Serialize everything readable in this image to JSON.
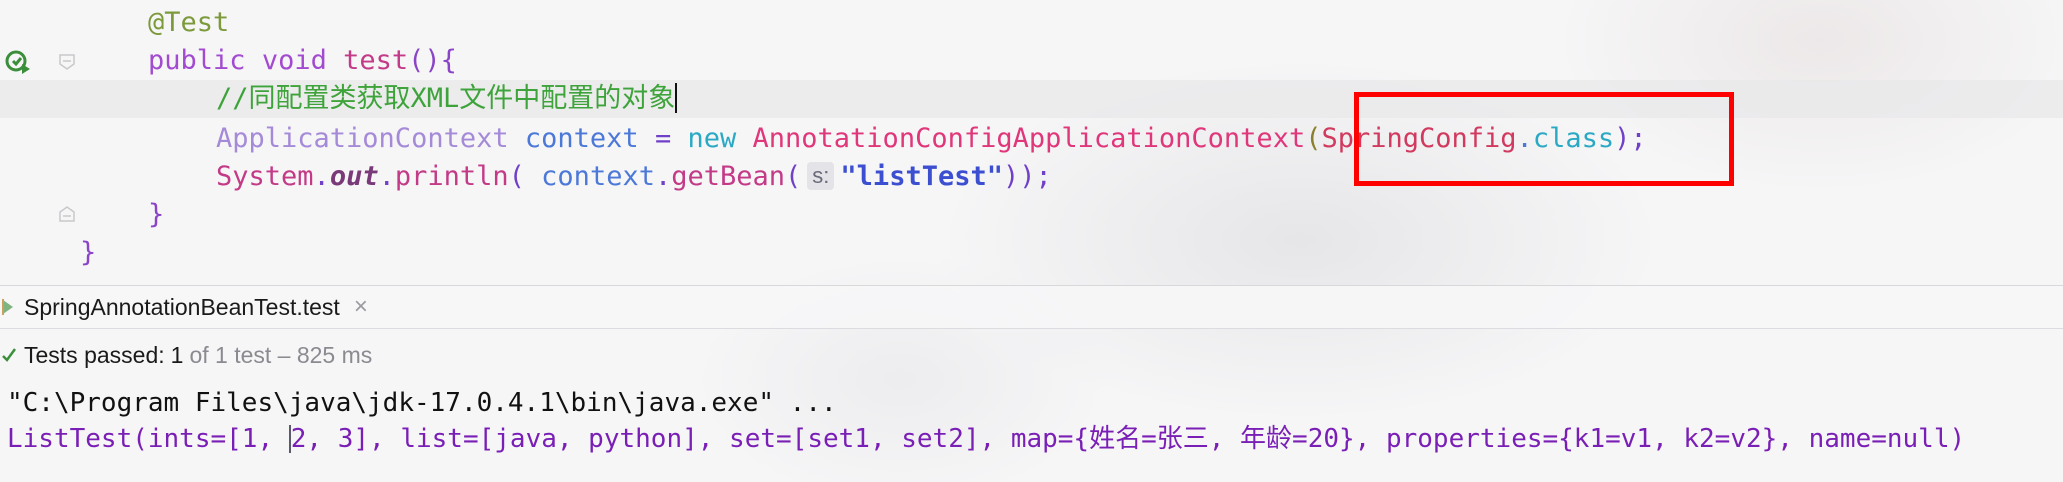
{
  "editor": {
    "lines": {
      "annotation": "@Test",
      "kw_public": "public",
      "kw_void": "void",
      "method_name": "test",
      "method_tail": "(){",
      "comment": "//同配置类获取XML文件中配置的对象",
      "type_appctx": "ApplicationContext",
      "var_context": "context",
      "op_assign": "=",
      "kw_new": "new",
      "class_anno_ctx": "AnnotationConfigApplicationContext",
      "open_paren": "(",
      "class_spring_config": "SpringConfig",
      "dot": ".",
      "kw_class": "class",
      "close_stmt": ");",
      "system": "System",
      "field_out": "out",
      "method_println": "println",
      "paren_open_space": "( ",
      "var_context2": "context",
      "method_getbean": "getBean",
      "paren_open": "(",
      "param_hint": "s:",
      "string_literal": "\"listTest\"",
      "close_call": "));",
      "close_method": "}",
      "close_class": "}"
    }
  },
  "run_panel": {
    "tab_label": "SpringAnnotationBeanTest.test",
    "tab_close": "×",
    "status_label": "Tests passed:",
    "status_count": "1",
    "status_rest": "of 1 test – 825 ms",
    "console": {
      "command": "\"C:\\Program Files\\java\\jdk-17.0.4.1\\bin\\java.exe\" ...",
      "output_a": "ListTest(ints=[1, ",
      "output_b": "2, 3], list=[java, python], set=[set1, set2], map={姓名=张三, 年龄=20}, properties={k1=v1, k2=v2}, name=null)"
    }
  },
  "colors": {
    "highlight_box": "#ff0000",
    "console_output": "#7a1fb5",
    "comment": "#3ea33a"
  }
}
